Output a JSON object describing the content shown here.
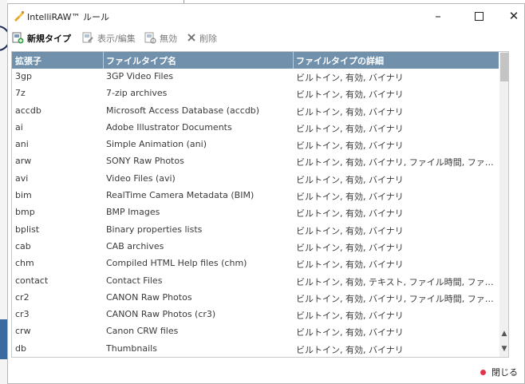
{
  "window": {
    "title": "IntelliRAW™ ルール",
    "controls": {
      "minimize": "–",
      "close": "✕"
    }
  },
  "toolbar": {
    "new_label": "新規タイプ",
    "edit_label": "表示/編集",
    "disable_label": "無効",
    "delete_label": "削除"
  },
  "table": {
    "headers": [
      "拡張子",
      "ファイルタイプ名",
      "ファイルタイプの詳細"
    ],
    "rows": [
      {
        "ext": "3gp",
        "name": "3GP Video Files",
        "detail": "ビルトイン, 有効, バイナリ"
      },
      {
        "ext": "7z",
        "name": "7-zip archives",
        "detail": "ビルトイン, 有効, バイナリ"
      },
      {
        "ext": "accdb",
        "name": "Microsoft Access Database (accdb)",
        "detail": "ビルトイン, 有効, バイナリ"
      },
      {
        "ext": "ai",
        "name": "Adobe Illustrator Documents",
        "detail": "ビルトイン, 有効, バイナリ"
      },
      {
        "ext": "ani",
        "name": "Simple Animation (ani)",
        "detail": "ビルトイン, 有効, バイナリ"
      },
      {
        "ext": "arw",
        "name": "SONY Raw Photos",
        "detail": "ビルトイン, 有効, バイナリ, ファイル時間, ファイ..."
      },
      {
        "ext": "avi",
        "name": "Video Files (avi)",
        "detail": "ビルトイン, 有効, バイナリ"
      },
      {
        "ext": "bim",
        "name": "RealTime Camera Metadata (BIM)",
        "detail": "ビルトイン, 有効, バイナリ"
      },
      {
        "ext": "bmp",
        "name": "BMP Images",
        "detail": "ビルトイン, 有効, バイナリ"
      },
      {
        "ext": "bplist",
        "name": "Binary properties lists",
        "detail": "ビルトイン, 有効, バイナリ"
      },
      {
        "ext": "cab",
        "name": "CAB archives",
        "detail": "ビルトイン, 有効, バイナリ"
      },
      {
        "ext": "chm",
        "name": "Compiled HTML Help files (chm)",
        "detail": "ビルトイン, 有効, バイナリ"
      },
      {
        "ext": "contact",
        "name": "Contact Files",
        "detail": "ビルトイン, 有効, テキスト, ファイル時間, ファイ..."
      },
      {
        "ext": "cr2",
        "name": "CANON Raw Photos",
        "detail": "ビルトイン, 有効, バイナリ, ファイル時間, ファイ..."
      },
      {
        "ext": "cr3",
        "name": "CANON Raw Photos (cr3)",
        "detail": "ビルトイン, 有効, バイナリ"
      },
      {
        "ext": "crw",
        "name": "Canon CRW files",
        "detail": "ビルトイン, 有効, バイナリ"
      },
      {
        "ext": "db",
        "name": "Thumbnails",
        "detail": "ビルトイン, 有効, バイナリ"
      }
    ]
  },
  "footer": {
    "close_label": "閉じる"
  },
  "colors": {
    "header_bg": "#7090ac",
    "accent_dot": "#e0344b"
  }
}
